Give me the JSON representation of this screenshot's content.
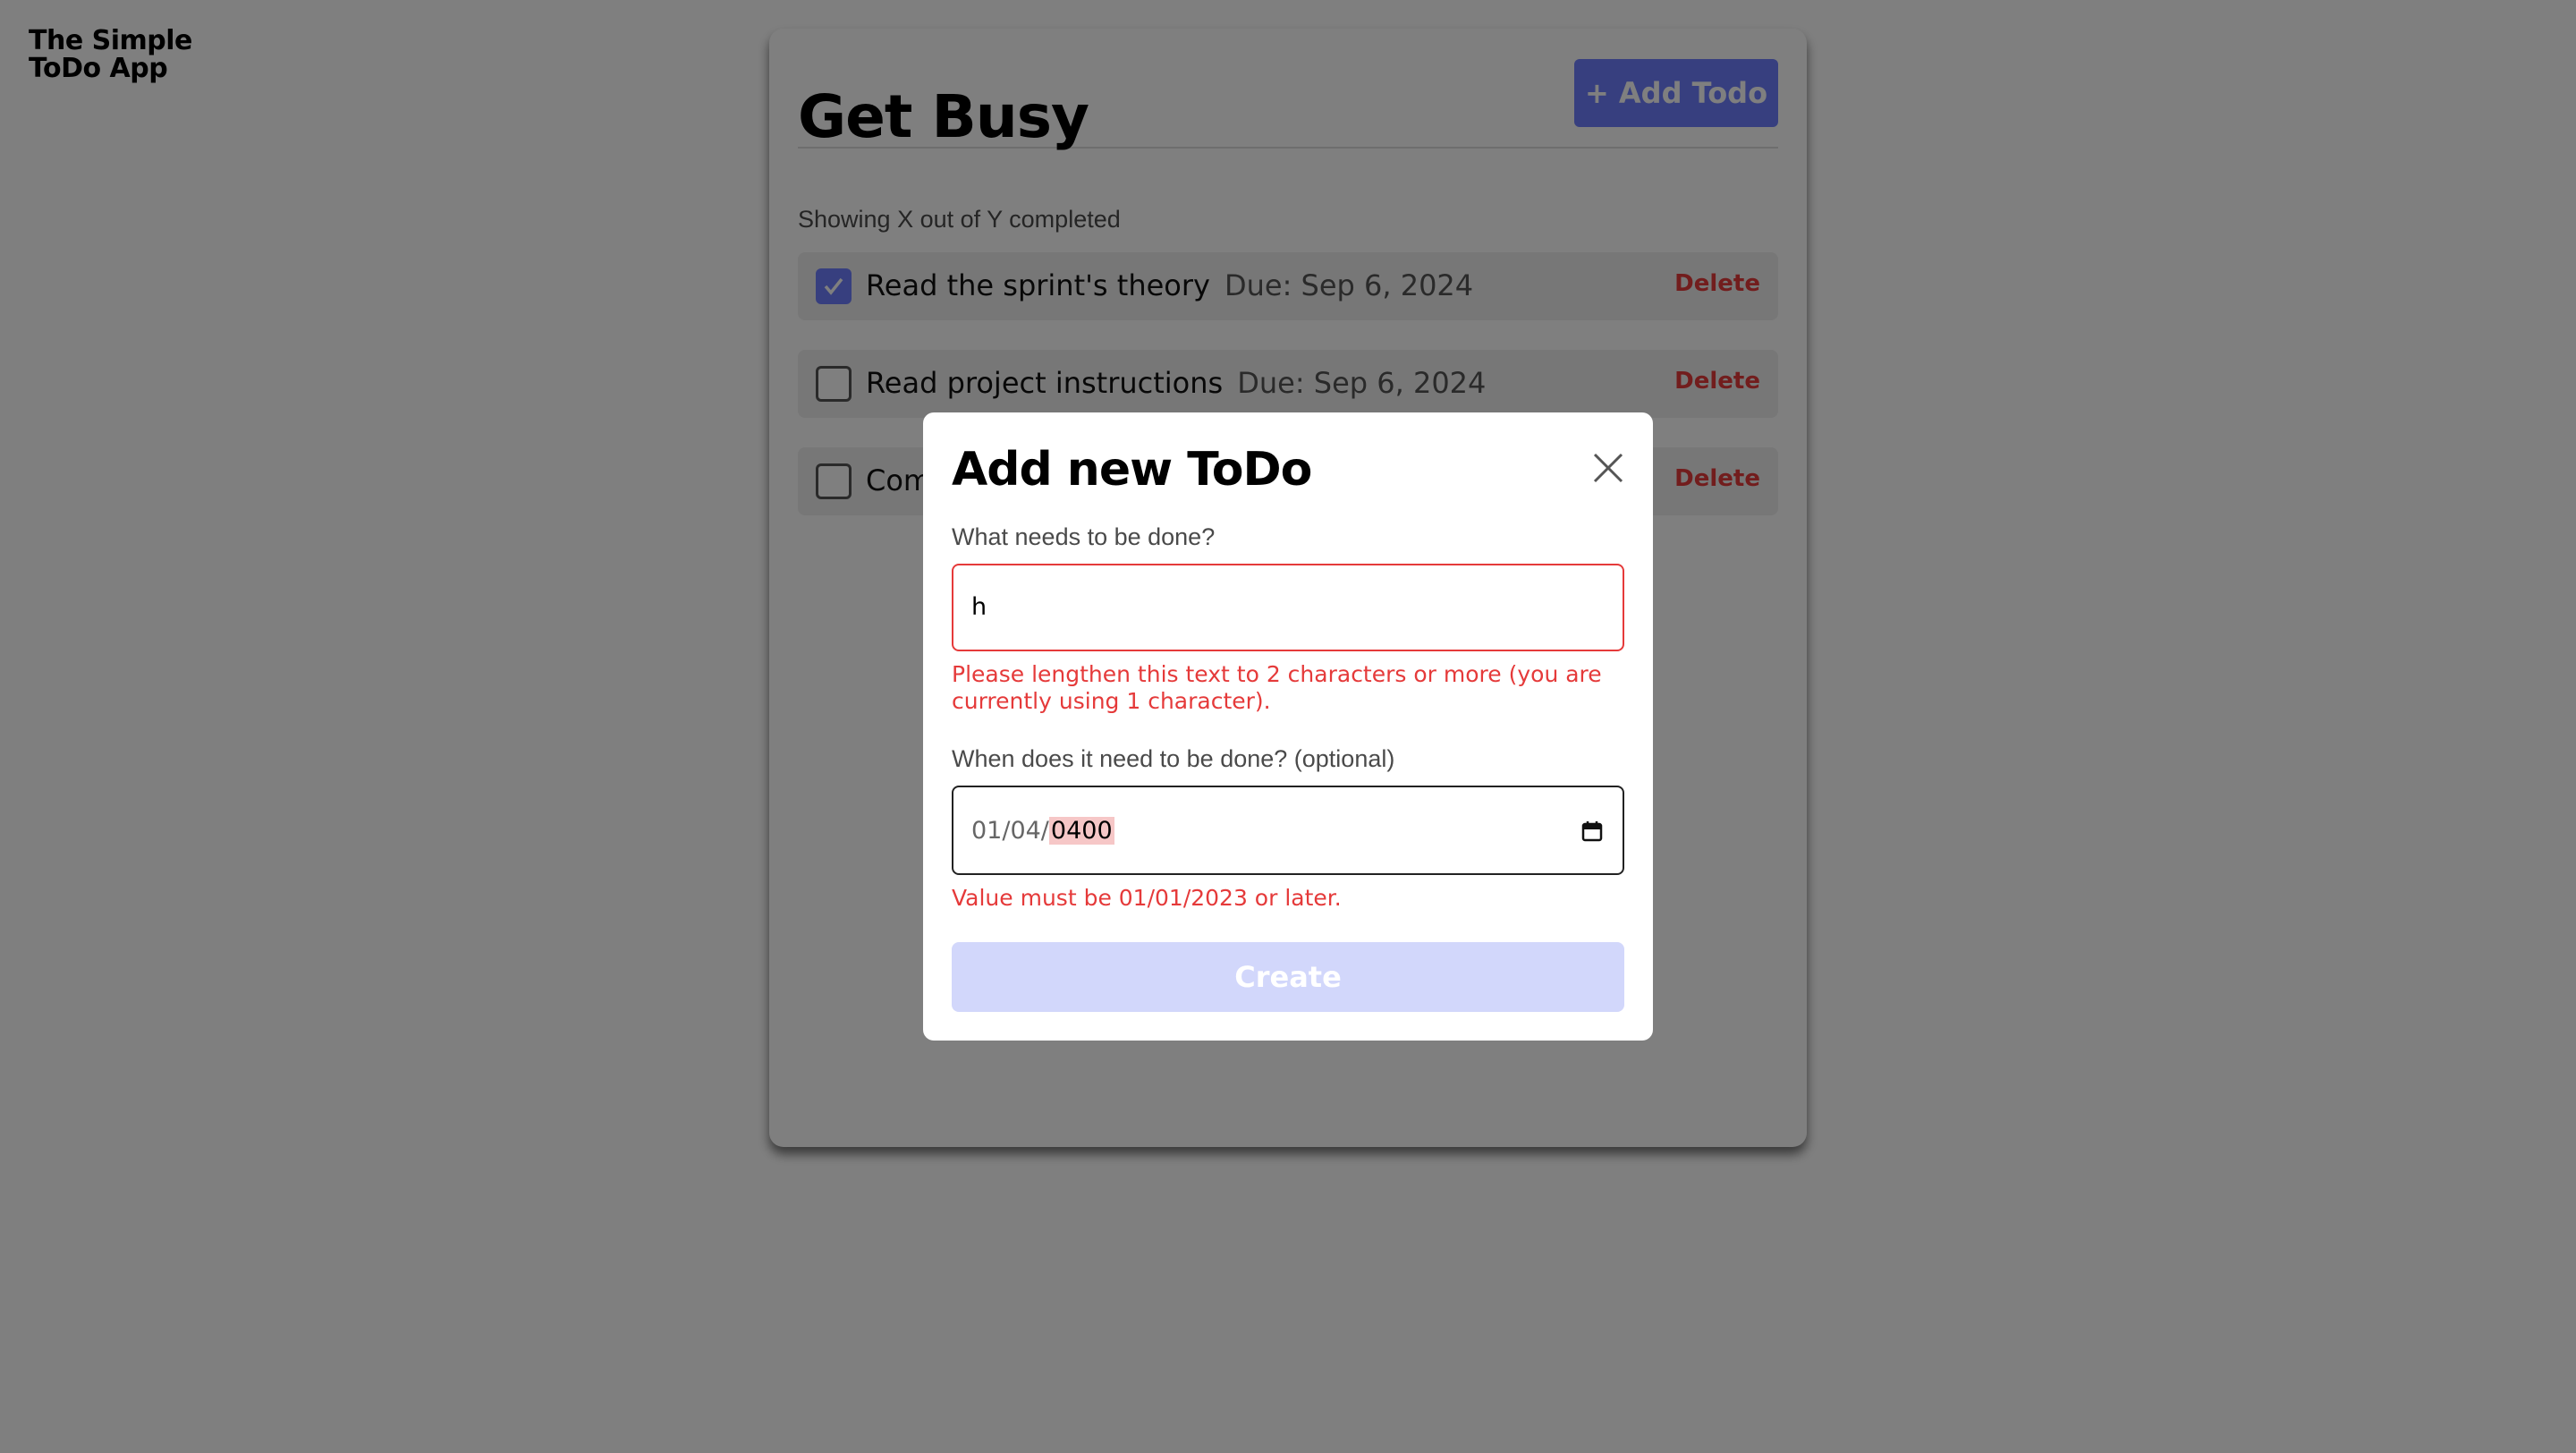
{
  "app": {
    "logo_line1": "The Simple",
    "logo_line2": "ToDo App"
  },
  "header": {
    "title": "Get Busy",
    "add_button": "+ Add Todo"
  },
  "summary": "Showing X out of Y completed",
  "todos": [
    {
      "text": "Read the sprint's theory",
      "due": "Due: Sep 6, 2024",
      "completed": true,
      "delete_label": "Delete"
    },
    {
      "text": "Read project instructions",
      "due": "Due: Sep 6, 2024",
      "completed": false,
      "delete_label": "Delete"
    },
    {
      "text": "Com",
      "due": "",
      "completed": false,
      "delete_label": "Delete"
    }
  ],
  "modal": {
    "title": "Add new ToDo",
    "close_icon": "close-icon",
    "text_label": "What needs to be done?",
    "text_value": "h",
    "text_error": "Please lengthen this text to 2 characters or more (you are currently using 1 character).",
    "date_label": "When does it need to be done? (optional)",
    "date_prefix": "01/04/",
    "date_year": "0400",
    "date_error": "Value must be 01/01/2023 or later.",
    "date_icon": "calendar-icon",
    "create_label": "Create"
  },
  "colors": {
    "accent": "#6f7fff",
    "danger": "#e53a3a",
    "accent_disabled": "#d2d7fb"
  }
}
